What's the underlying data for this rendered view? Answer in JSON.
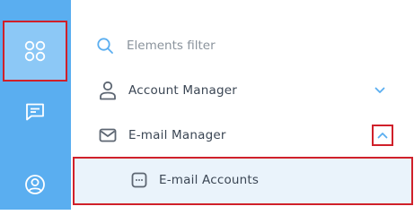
{
  "rail": {
    "items": [
      {
        "icon": "apps-grid-icon",
        "active": true
      },
      {
        "icon": "chat-icon",
        "active": false
      },
      {
        "icon": "user-profile-icon",
        "active": false
      }
    ],
    "colors": {
      "background": "#5aaef0",
      "active": "#8cc8f6",
      "highlight": "#d0202a"
    }
  },
  "filter": {
    "placeholder": "Elements filter",
    "value": "",
    "icon": "search-icon"
  },
  "menu": {
    "items": [
      {
        "label": "Account Manager",
        "icon": "person-icon",
        "expanded": false,
        "chevron": "chevron-down-icon"
      },
      {
        "label": "E-mail Manager",
        "icon": "envelope-icon",
        "expanded": true,
        "chevron": "chevron-up-icon",
        "children": [
          {
            "label": "E-mail Accounts",
            "icon": "card-icon"
          }
        ]
      }
    ]
  }
}
